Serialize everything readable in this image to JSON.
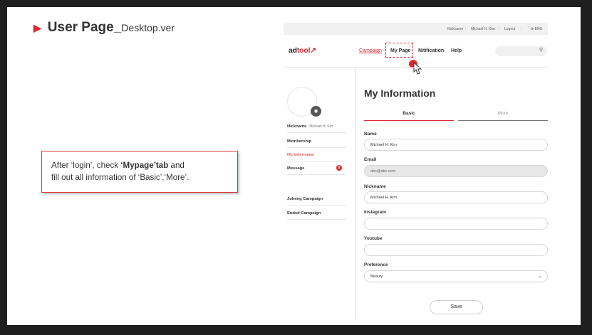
{
  "slide": {
    "title_main": "User Page_",
    "title_sub": "Desktop.ver",
    "callout_pre": "After ‘login’,  check ",
    "callout_bold": "‘Mypage’tab",
    "callout_post": " and",
    "callout_line2": "fill out all information of ‘Basic’,‘More’."
  },
  "topbar": {
    "nickname_label": "Nickname",
    "nickname_value": "Michael H. Kim",
    "logout": "Logout",
    "language": "⊕ ENG"
  },
  "header": {
    "logo_part1": "ad",
    "logo_part2": "tool",
    "logo_mark": "↗",
    "nav": [
      "Campaign",
      "My Page",
      "Nitification",
      "Help"
    ],
    "search_icon": "search-icon"
  },
  "sidebar": {
    "nickname_label": "Nickname",
    "nickname_value": "Michael H. Kim",
    "items": [
      "Membership",
      "My Information",
      "Message",
      "Joining Campaign",
      "Ended Campaign"
    ],
    "message_badge": "0"
  },
  "main": {
    "heading": "My Information",
    "tabs": [
      "Basic",
      "More"
    ],
    "fields": [
      {
        "label": "Name",
        "value": "Michael H. Kim"
      },
      {
        "label": "Email",
        "value": "abc@abc.com"
      },
      {
        "label": "Nickname",
        "value": "Michael H. Kim"
      },
      {
        "label": "Instagram",
        "value": ""
      },
      {
        "label": "Youtube",
        "value": ""
      },
      {
        "label": "Preference",
        "value": "Beauty"
      }
    ],
    "save": "Save"
  },
  "colors": {
    "accent": "#e0292e",
    "slide_bg": "#1f1f1f"
  }
}
